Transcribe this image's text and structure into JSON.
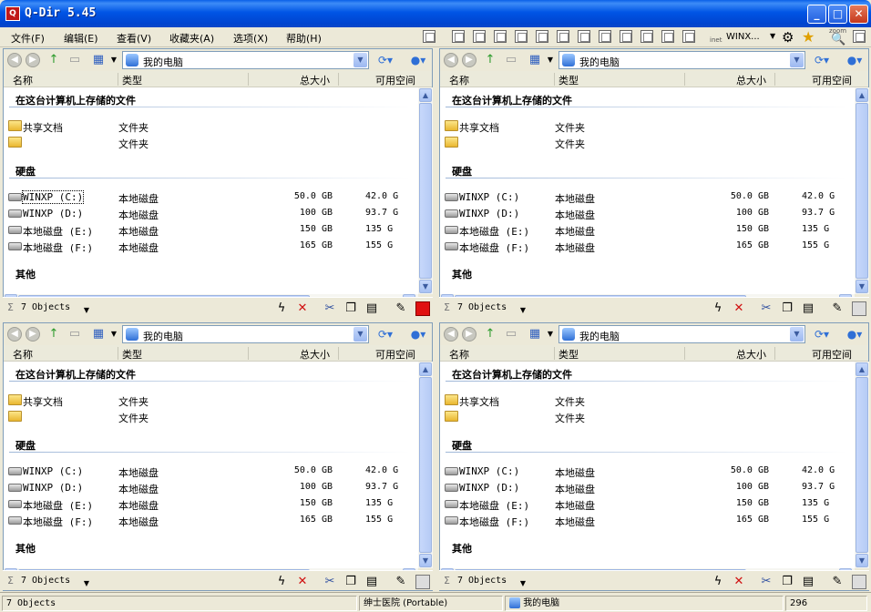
{
  "window": {
    "title": "Q-Dir 5.45",
    "app_icon_glyph": "Q"
  },
  "menu": [
    "文件(F)",
    "编辑(E)",
    "查看(V)",
    "收藏夹(A)",
    "选项(X)",
    "帮助(H)"
  ],
  "toolbar": {
    "winx_label": "WINX...",
    "inet_label": "inet",
    "zoom_label": "zoom"
  },
  "panes": [
    {
      "address": "我的电脑",
      "columns": {
        "name": "名称",
        "type": "类型",
        "total": "总大小",
        "free": "可用空间"
      },
      "group_stored": "在这台计算机上存储的文件",
      "group_disks": "硬盘",
      "group_other": "其他",
      "folders": [
        {
          "name": "共享文档",
          "type": "文件夹"
        },
        {
          "name": "",
          "type": "文件夹"
        }
      ],
      "drives": [
        {
          "name": "WINXP (C:)",
          "type": "本地磁盘",
          "total": "50.0 GB",
          "free": "42.0 G"
        },
        {
          "name": "WINXP (D:)",
          "type": "本地磁盘",
          "total": "100 GB",
          "free": "93.7 G"
        },
        {
          "name": "本地磁盘 (E:)",
          "type": "本地磁盘",
          "total": "150 GB",
          "free": "135 G"
        },
        {
          "name": "本地磁盘 (F:)",
          "type": "本地磁盘",
          "total": "165 GB",
          "free": "155 G"
        }
      ],
      "status": "7 Objects"
    },
    {
      "address": "我的电脑",
      "columns": {
        "name": "名称",
        "type": "类型",
        "total": "总大小",
        "free": "可用空间"
      },
      "group_stored": "在这台计算机上存储的文件",
      "group_disks": "硬盘",
      "group_other": "其他",
      "folders": [
        {
          "name": "共享文档",
          "type": "文件夹"
        },
        {
          "name": "",
          "type": "文件夹"
        }
      ],
      "drives": [
        {
          "name": "WINXP (C:)",
          "type": "本地磁盘",
          "total": "50.0 GB",
          "free": "42.0 G"
        },
        {
          "name": "WINXP (D:)",
          "type": "本地磁盘",
          "total": "100 GB",
          "free": "93.7 G"
        },
        {
          "name": "本地磁盘 (E:)",
          "type": "本地磁盘",
          "total": "150 GB",
          "free": "135 G"
        },
        {
          "name": "本地磁盘 (F:)",
          "type": "本地磁盘",
          "total": "165 GB",
          "free": "155 G"
        }
      ],
      "status": "7 Objects"
    },
    {
      "address": "我的电脑",
      "columns": {
        "name": "名称",
        "type": "类型",
        "total": "总大小",
        "free": "可用空间"
      },
      "group_stored": "在这台计算机上存储的文件",
      "group_disks": "硬盘",
      "group_other": "其他",
      "folders": [
        {
          "name": "共享文档",
          "type": "文件夹"
        },
        {
          "name": "",
          "type": "文件夹"
        }
      ],
      "drives": [
        {
          "name": "WINXP (C:)",
          "type": "本地磁盘",
          "total": "50.0 GB",
          "free": "42.0 G"
        },
        {
          "name": "WINXP (D:)",
          "type": "本地磁盘",
          "total": "100 GB",
          "free": "93.7 G"
        },
        {
          "name": "本地磁盘 (E:)",
          "type": "本地磁盘",
          "total": "150 GB",
          "free": "135 G"
        },
        {
          "name": "本地磁盘 (F:)",
          "type": "本地磁盘",
          "total": "165 GB",
          "free": "155 G"
        }
      ],
      "status": "7 Objects"
    },
    {
      "address": "我的电脑",
      "columns": {
        "name": "名称",
        "type": "类型",
        "total": "总大小",
        "free": "可用空间"
      },
      "group_stored": "在这台计算机上存储的文件",
      "group_disks": "硬盘",
      "group_other": "其他",
      "folders": [
        {
          "name": "共享文档",
          "type": "文件夹"
        },
        {
          "name": "",
          "type": "文件夹"
        }
      ],
      "drives": [
        {
          "name": "WINXP (C:)",
          "type": "本地磁盘",
          "total": "50.0 GB",
          "free": "42.0 G"
        },
        {
          "name": "WINXP (D:)",
          "type": "本地磁盘",
          "total": "100 GB",
          "free": "93.7 G"
        },
        {
          "name": "本地磁盘 (E:)",
          "type": "本地磁盘",
          "total": "150 GB",
          "free": "135 G"
        },
        {
          "name": "本地磁盘 (F:)",
          "type": "本地磁盘",
          "total": "165 GB",
          "free": "155 G"
        }
      ],
      "status": "7 Objects"
    }
  ],
  "statusbar": {
    "objects": "7 Objects",
    "location": "绅士医院 (Portable)",
    "path": "我的电脑",
    "number": "296"
  },
  "colors": {
    "titlebar": "#0055e5",
    "close_red": "#c5381c",
    "panel_bg": "#ece9d8"
  }
}
